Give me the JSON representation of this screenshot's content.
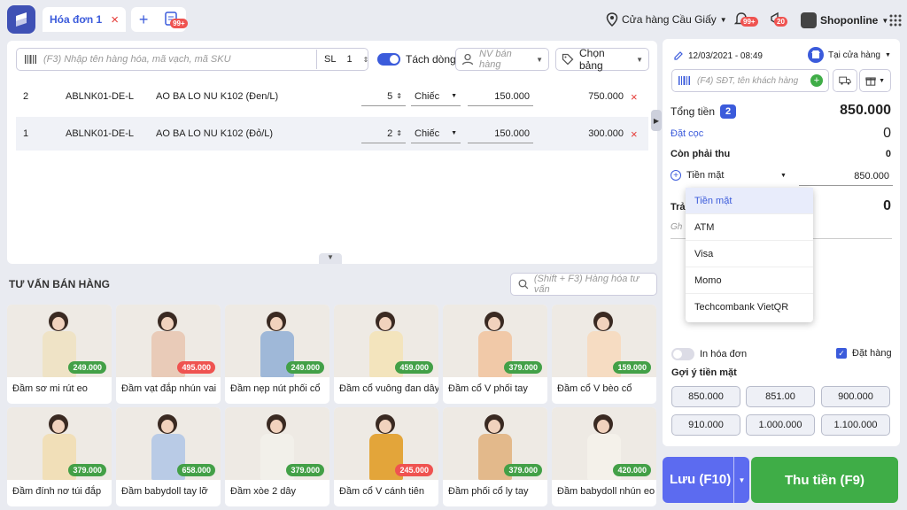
{
  "topbar": {
    "tab_label": "Hóa đơn 1",
    "tab_close": "×",
    "add_tab": "+",
    "invoice_badge": "99+",
    "store_name": "Cửa hàng Cầu Giấy",
    "notification_badge": "99+",
    "alert_badge": "20",
    "account_name": "Shoponline"
  },
  "order": {
    "search_placeholder": "(F3) Nhập tên hàng hóa, mã vạch, mã SKU",
    "qty_label": "SL",
    "qty_value": "1",
    "split_label": "Tách dòng",
    "staff_placeholder": "NV bán hàng",
    "price_table_label": "Chọn bảng",
    "rows": [
      {
        "idx": "2",
        "sku": "ABLNK01-DE-L",
        "name": "AO BA LO NU K102 (Đen/L)",
        "qty": "5",
        "unit": "Chiếc",
        "price": "150.000",
        "total": "750.000"
      },
      {
        "idx": "1",
        "sku": "ABLNK01-DE-L",
        "name": "AO BA LO NU K102 (Đỏ/L)",
        "qty": "2",
        "unit": "Chiếc",
        "price": "150.000",
        "total": "300.000"
      }
    ]
  },
  "suggestions": {
    "title": "TƯ VẤN BÁN HÀNG",
    "search_placeholder": "(Shift + F3) Hàng hóa tư vấn",
    "products": [
      {
        "name": "Đầm sơ mi rút eo",
        "price": "249.000",
        "tag": "green",
        "color": "#efe3c6"
      },
      {
        "name": "Đầm vạt đắp nhún vai",
        "price": "495.000",
        "tag": "red",
        "color": "#e9cbb8"
      },
      {
        "name": "Đầm nẹp nút phối cổ",
        "price": "249.000",
        "tag": "green",
        "color": "#9fb8d8"
      },
      {
        "name": "Đầm cổ vuông đan dây",
        "price": "459.000",
        "tag": "green",
        "color": "#f3e4bd"
      },
      {
        "name": "Đầm cổ V phối tay",
        "price": "379.000",
        "tag": "green",
        "color": "#f1c9a8"
      },
      {
        "name": "Đầm cổ V bèo cổ",
        "price": "159.000",
        "tag": "green",
        "color": "#f6dcc2"
      },
      {
        "name": "Đầm đính nơ túi đắp",
        "price": "379.000",
        "tag": "green",
        "color": "#f1dfb8"
      },
      {
        "name": "Đầm babydoll tay lỡ",
        "price": "658.000",
        "tag": "green",
        "color": "#b9cbe6"
      },
      {
        "name": "Đầm xòe 2 dây",
        "price": "379.000",
        "tag": "green",
        "color": "#f2f0ea"
      },
      {
        "name": "Đầm cổ V cánh tiên",
        "price": "245.000",
        "tag": "red",
        "color": "#e3a53a"
      },
      {
        "name": "Đầm phối cổ ly tay",
        "price": "379.000",
        "tag": "green",
        "color": "#e3b98b"
      },
      {
        "name": "Đầm babydoll nhún eo",
        "price": "420.000",
        "tag": "green",
        "color": "#f4f1ea"
      }
    ]
  },
  "checkout": {
    "datetime": "12/03/2021 - 08:49",
    "channel": "Tại cửa hàng",
    "customer_placeholder": "(F4) SĐT, tên khách hàng",
    "total_label": "Tổng tiền",
    "total_count": "2",
    "total_value": "850.000",
    "deposit_label": "Đặt cọc",
    "deposit_value": "0",
    "remaining_label": "Còn phải thu",
    "remaining_value": "0",
    "payment_method": "Tiền mặt",
    "payment_amount": "850.000",
    "change_label_partial": "Trả",
    "change_value": "0",
    "note_placeholder_partial": "Gh",
    "print_label": "In hóa đơn",
    "order_label": "Đặt hàng",
    "cash_suggest_label": "Gợi ý tiền mặt",
    "cash_suggestions": [
      "850.000",
      "851.00",
      "900.000",
      "910.000",
      "1.000.000",
      "1.100.000"
    ],
    "payment_options": [
      "Tiền mặt",
      "ATM",
      "Visa",
      "Momo",
      "Techcombank VietQR"
    ],
    "save_label": "Lưu (F10)",
    "pay_label": "Thu tiền (F9)"
  },
  "colors": {
    "accent": "#3b5bdb",
    "pay_button": "#3fad47",
    "save_button": "#5c6bf0",
    "price_green": "#43a047",
    "price_red": "#ef5350"
  }
}
